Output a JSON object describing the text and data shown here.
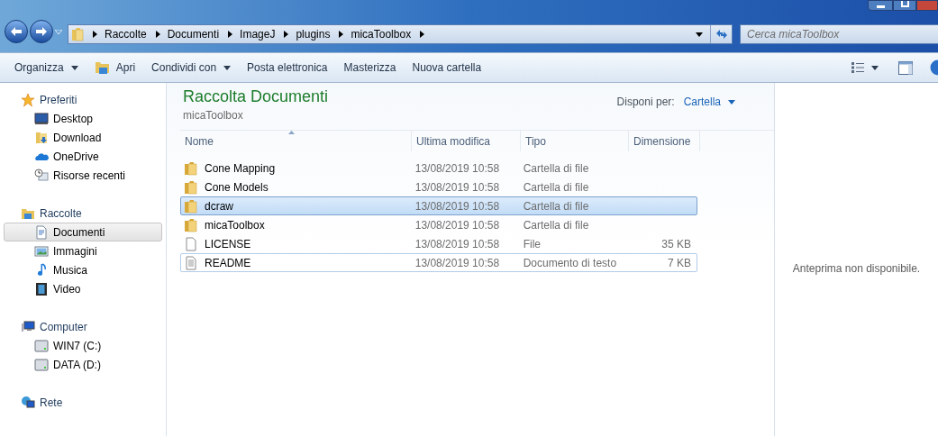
{
  "address_bar": {
    "path": [
      "Raccolte",
      "Documenti",
      "ImageJ",
      "plugins",
      "micaToolbox"
    ]
  },
  "search": {
    "placeholder": "Cerca micaToolbox"
  },
  "toolbar": [
    {
      "label": "Organizza",
      "dropdown": true,
      "kind": "plain"
    },
    {
      "label": "Apri",
      "dropdown": false,
      "kind": "open"
    },
    {
      "label": "Condividi con",
      "dropdown": true,
      "kind": "plain"
    },
    {
      "label": "Posta elettronica",
      "dropdown": false,
      "kind": "plain"
    },
    {
      "label": "Masterizza",
      "dropdown": false,
      "kind": "plain"
    },
    {
      "label": "Nuova cartella",
      "dropdown": false,
      "kind": "plain"
    }
  ],
  "sidebar": {
    "groups": [
      {
        "label": "Preferiti",
        "kind": "favorites",
        "children": [
          {
            "label": "Desktop",
            "kind": "desktop",
            "selected": false
          },
          {
            "label": "Download",
            "kind": "download",
            "selected": false
          },
          {
            "label": "OneDrive",
            "kind": "cloud",
            "selected": false
          },
          {
            "label": "Risorse recenti",
            "kind": "recent",
            "selected": false
          }
        ]
      },
      {
        "label": "Raccolte",
        "kind": "library",
        "children": [
          {
            "label": "Documenti",
            "kind": "document",
            "selected": true
          },
          {
            "label": "Immagini",
            "kind": "image",
            "selected": false
          },
          {
            "label": "Musica",
            "kind": "music",
            "selected": false
          },
          {
            "label": "Video",
            "kind": "video",
            "selected": false
          }
        ]
      },
      {
        "label": "Computer",
        "kind": "computer",
        "children": [
          {
            "label": "WIN7 (C:)",
            "kind": "drive",
            "selected": false
          },
          {
            "label": "DATA (D:)",
            "kind": "drive",
            "selected": false
          }
        ]
      },
      {
        "label": "Rete",
        "kind": "network"
      }
    ]
  },
  "library": {
    "title": "Raccolta Documenti",
    "subtitle": "micaToolbox",
    "arrange_label": "Disponi per:",
    "arrange_value": "Cartella"
  },
  "table": {
    "columns": [
      "Nome",
      "Ultima modifica",
      "Tipo",
      "Dimensione"
    ],
    "rows": [
      {
        "kind": "folder",
        "name": "Cone Mapping",
        "modified": "13/08/2019 10:58",
        "type": "Cartella di file",
        "selected": false,
        "focused": false
      },
      {
        "kind": "folder",
        "name": "Cone Models",
        "modified": "13/08/2019 10:58",
        "type": "Cartella di file",
        "selected": false,
        "focused": false
      },
      {
        "kind": "folder",
        "name": "dcraw",
        "modified": "13/08/2019 10:58",
        "type": "Cartella di file",
        "selected": true,
        "focused": false
      },
      {
        "kind": "folder",
        "name": "micaToolbox",
        "modified": "13/08/2019 10:58",
        "type": "Cartella di file",
        "selected": false,
        "focused": false
      },
      {
        "kind": "file",
        "name": "LICENSE",
        "modified": "13/08/2019 10:58",
        "type": "File",
        "size": "35 KB",
        "selected": false,
        "focused": false
      },
      {
        "kind": "text",
        "name": "README",
        "modified": "13/08/2019 10:58",
        "type": "Documento di testo",
        "size": "7 KB",
        "selected": false,
        "focused": true
      }
    ]
  },
  "preview": {
    "message": "Anteprima non disponibile."
  }
}
